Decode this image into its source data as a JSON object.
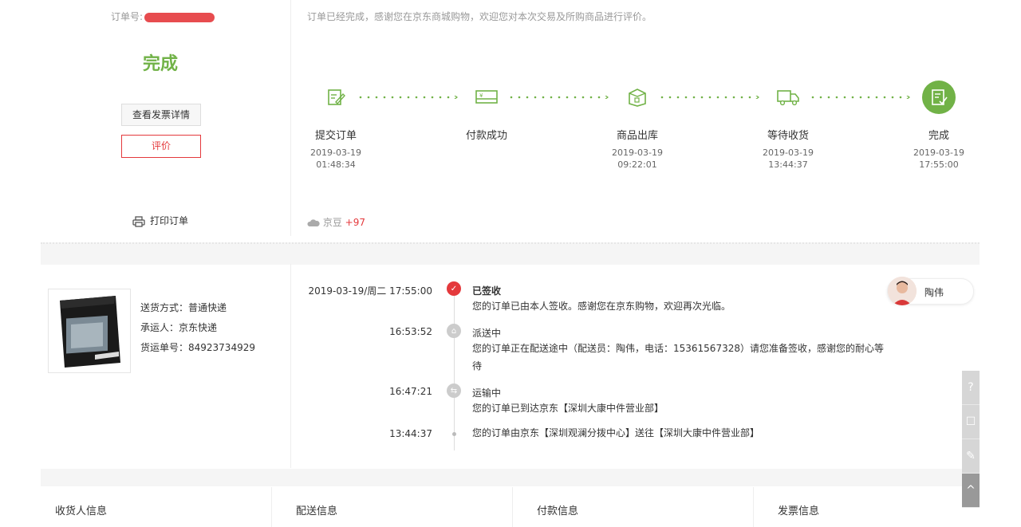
{
  "order": {
    "number_label": "订单号:",
    "status": "完成",
    "invoice_button": "查看发票详情",
    "review_button": "评价",
    "print_label": "打印订单",
    "message": "订单已经完成，感谢您在京东商城购物，欢迎您对本次交易及所购商品进行评价。",
    "beans_label": "京豆",
    "beans_value": "+97"
  },
  "steps": [
    {
      "name": "提交订单",
      "date": "2019-03-19",
      "time": "01:48:34",
      "icon": "edit-order-icon"
    },
    {
      "name": "付款成功",
      "date": "",
      "time": "",
      "icon": "payment-card-icon"
    },
    {
      "name": "商品出库",
      "date": "2019-03-19",
      "time": "09:22:01",
      "icon": "package-box-icon"
    },
    {
      "name": "等待收货",
      "date": "2019-03-19",
      "time": "13:44:37",
      "icon": "delivery-truck-icon"
    },
    {
      "name": "完成",
      "date": "2019-03-19",
      "time": "17:55:00",
      "icon": "complete-check-icon"
    }
  ],
  "shipping": {
    "method": "送货方式：普通快递",
    "carrier": "承运人：京东快递",
    "tracking": "货运单号：84923734929"
  },
  "timeline": [
    {
      "time": "2019-03-19/周二  17:55:00",
      "title": "已签收",
      "desc": "您的订单已由本人签收。感谢您在京东购物，欢迎再次光临。"
    },
    {
      "time": "16:53:52",
      "title": "派送中",
      "desc": "您的订单正在配送途中（配送员：陶伟，电话：15361567328）请您准备签收，感谢您的耐心等待"
    },
    {
      "time": "16:47:21",
      "title": "运输中",
      "desc": "您的订单已到达京东【深圳大康中件营业部】"
    },
    {
      "time": "13:44:37",
      "title": "",
      "desc": "您的订单由京东【深圳观澜分拨中心】送往【深圳大康中件营业部】"
    }
  ],
  "courier": {
    "name": "陶伟"
  },
  "info_tabs": [
    "收货人信息",
    "配送信息",
    "付款信息",
    "发票信息"
  ],
  "colors": {
    "accent_green": "#71b247",
    "accent_red": "#e4393c"
  }
}
